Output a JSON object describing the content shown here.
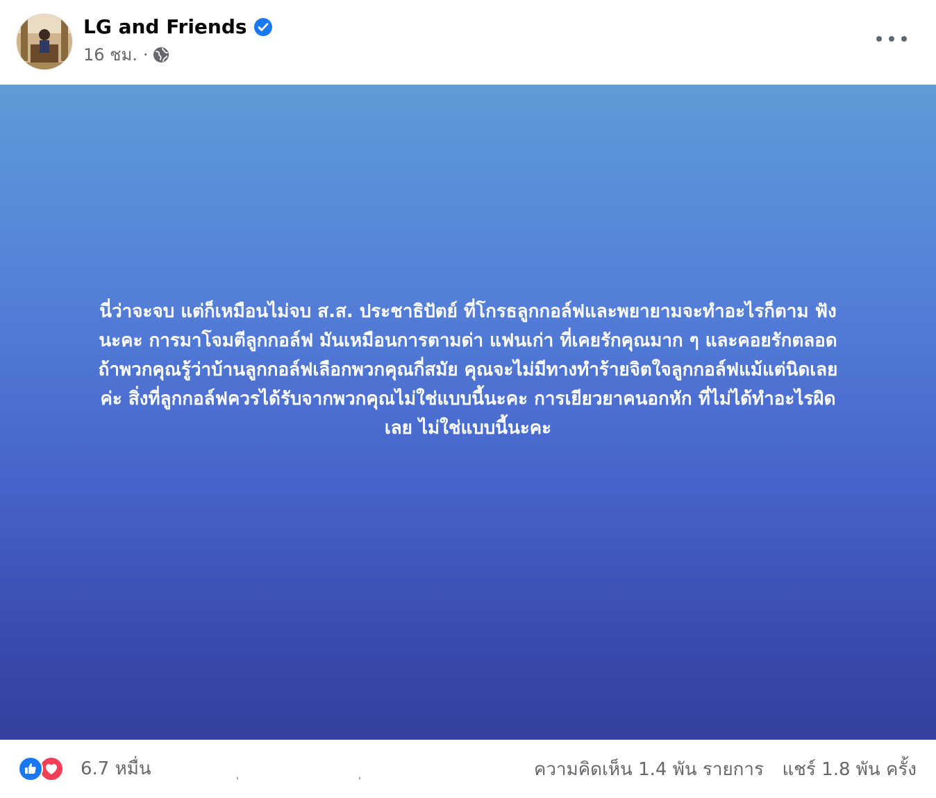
{
  "post": {
    "page_name": "LG and Friends",
    "time": "16 ชม.",
    "separator": "·",
    "verified_icon": "verified-badge-icon",
    "privacy_icon": "globe-icon",
    "more_icon": "more-options-icon",
    "background_gradient": [
      "#5e9bd7",
      "#5581d9",
      "#4665cc",
      "#3a4aae",
      "#35409d"
    ],
    "text_lines": [
      "นี่ว่าจะจบ แต่ก็เหมือนไม่จบ ส.ส. ประชาธิปัตย์ ที่โกรธลูกกอล์ฟและพยายามจะทำอะไรก็ตาม ฟัง",
      "นะคะ การมาโจมตีลูกกอล์ฟ มันเหมือนการตามด่า แฟนเก่า ที่เคยรักคุณมาก ๆ และคอยรักตลอด",
      "ถ้าพวกคุณรู้ว่าบ้านลูกกอล์ฟเลือกพวกคุณกี่สมัย คุณจะไม่มีทางทำร้ายจิตใจลูกกอล์ฟแม้แต่นิดเลย",
      "ค่ะ สิ่งที่ลูกกอล์ฟควรได้รับจากพวกคุณไม่ใช่แบบนี้นะคะ การเยียวยาคนอกหัก ที่ไม่ได้ทำอะไรผิด",
      "เลย ไม่ใช่แบบนี้นะคะ"
    ]
  },
  "footer": {
    "reaction_icons": [
      "like-reaction-icon",
      "love-reaction-icon"
    ],
    "reaction_count": "6.7 หมื่น",
    "tick_marks": [
      "'",
      "'"
    ],
    "comments": "ความคิดเห็น 1.4 พัน รายการ",
    "shares": "แชร์ 1.8 พัน ครั้ง"
  }
}
